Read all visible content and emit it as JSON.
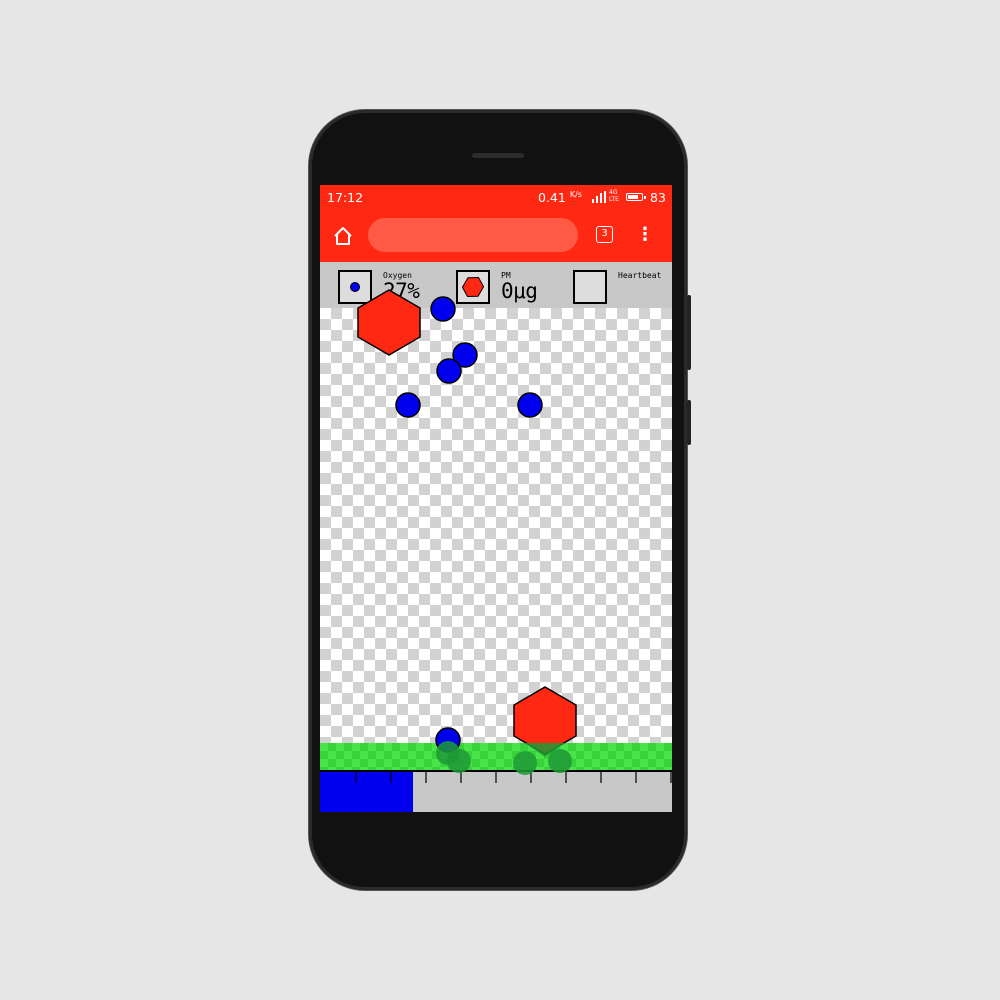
{
  "statusbar": {
    "time": "17:12",
    "net_speed": "0.41",
    "net_unit": "K/s",
    "network_type": "4G LTE",
    "battery": "83",
    "battery_fraction": 0.83
  },
  "toolbar": {
    "home_icon": "home-icon",
    "tab_count": "3",
    "menu_icon": "more-vert-icon"
  },
  "sensors": [
    {
      "label": "Oxygen",
      "value": "27%",
      "icon": "oxygen-dot-icon"
    },
    {
      "label": "PM",
      "value": "0μg",
      "icon": "pm-hexagon-icon"
    },
    {
      "label": "Heartbeat",
      "value": "",
      "icon": "heartbeat-icon"
    }
  ],
  "progress": {
    "fraction": 0.265
  },
  "colors": {
    "brand_red": "#ff2813",
    "oxygen_blue": "#0000ee",
    "pm_red": "#ff2813",
    "ground_green": "#49e34a",
    "panel_gray": "#c8c8c8"
  }
}
